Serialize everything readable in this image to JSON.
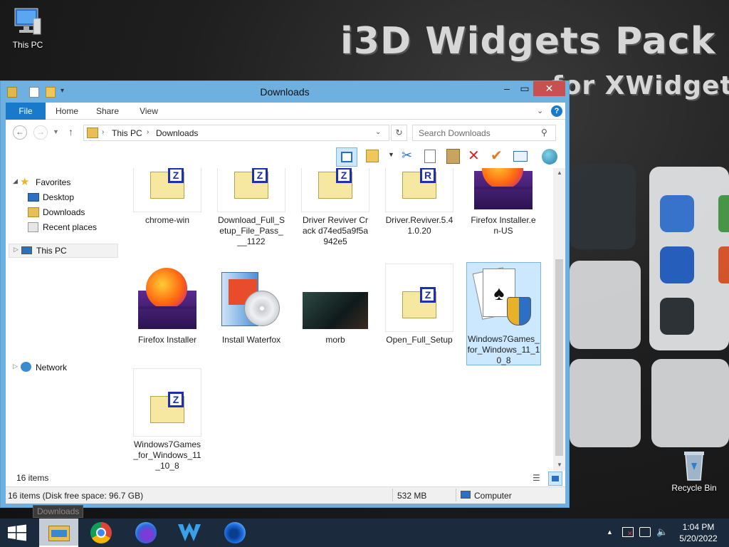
{
  "wallpaper": {
    "title_line1": "i3D Widgets Pack",
    "title_line2": "for XWidget"
  },
  "desktop_icons": [
    {
      "label": "This PC",
      "icon": "this-pc-icon"
    },
    {
      "label": "Recycle Bin",
      "icon": "recycle-bin-icon"
    }
  ],
  "window": {
    "title": "Downloads",
    "ribbon_tabs": [
      "File",
      "Home",
      "Share",
      "View"
    ],
    "breadcrumb": [
      "This PC",
      "Downloads"
    ],
    "search_placeholder": "Search Downloads",
    "nav": {
      "favorites": "Favorites",
      "favorites_items": [
        "Desktop",
        "Downloads",
        "Recent places"
      ],
      "this_pc": "This PC",
      "network": "Network"
    },
    "files": [
      {
        "name": "chrome-win",
        "icon": "zip-folder-icon"
      },
      {
        "name": "Download_Full_Setup_File_Pass___1122",
        "icon": "zip-folder-icon"
      },
      {
        "name": "Driver Reviver Crack d74ed5a9f5a942e5",
        "icon": "zip-folder-icon"
      },
      {
        "name": "Driver.Reviver.5.41.0.20",
        "icon": "rar-folder-icon"
      },
      {
        "name": "Firefox Installer.en-US",
        "icon": "firefox-installer-icon"
      },
      {
        "name": "Firefox Installer",
        "icon": "firefox-installer-icon"
      },
      {
        "name": "Install Waterfox",
        "icon": "installer-box-icon"
      },
      {
        "name": "morb",
        "icon": "video-thumbnail-icon"
      },
      {
        "name": "Open_Full_Setup",
        "icon": "zip-folder-icon"
      },
      {
        "name": "Windows7Games_for_Windows_11_10_8",
        "icon": "solitaire-cards-icon",
        "selected": true
      },
      {
        "name": "Windows7Games_for_Windows_11_10_8",
        "icon": "zip-folder-icon"
      }
    ],
    "item_count": "16 items",
    "details_status": "16 items (Disk free space: 96.7 GB)",
    "details_size": "532 MB",
    "details_location": "Computer"
  },
  "taskbar": {
    "tooltip": "Downloads",
    "apps": [
      "start-icon",
      "file-explorer-icon",
      "chrome-icon",
      "firefox-icon",
      "waterfox-icon",
      "firefox-nightly-icon"
    ],
    "time": "1:04 PM",
    "date": "5/20/2022"
  },
  "colors": {
    "accent": "#1979ca",
    "window_frame": "#6eb1e1",
    "close": "#c75050",
    "taskbar": "#1c2a3e"
  }
}
